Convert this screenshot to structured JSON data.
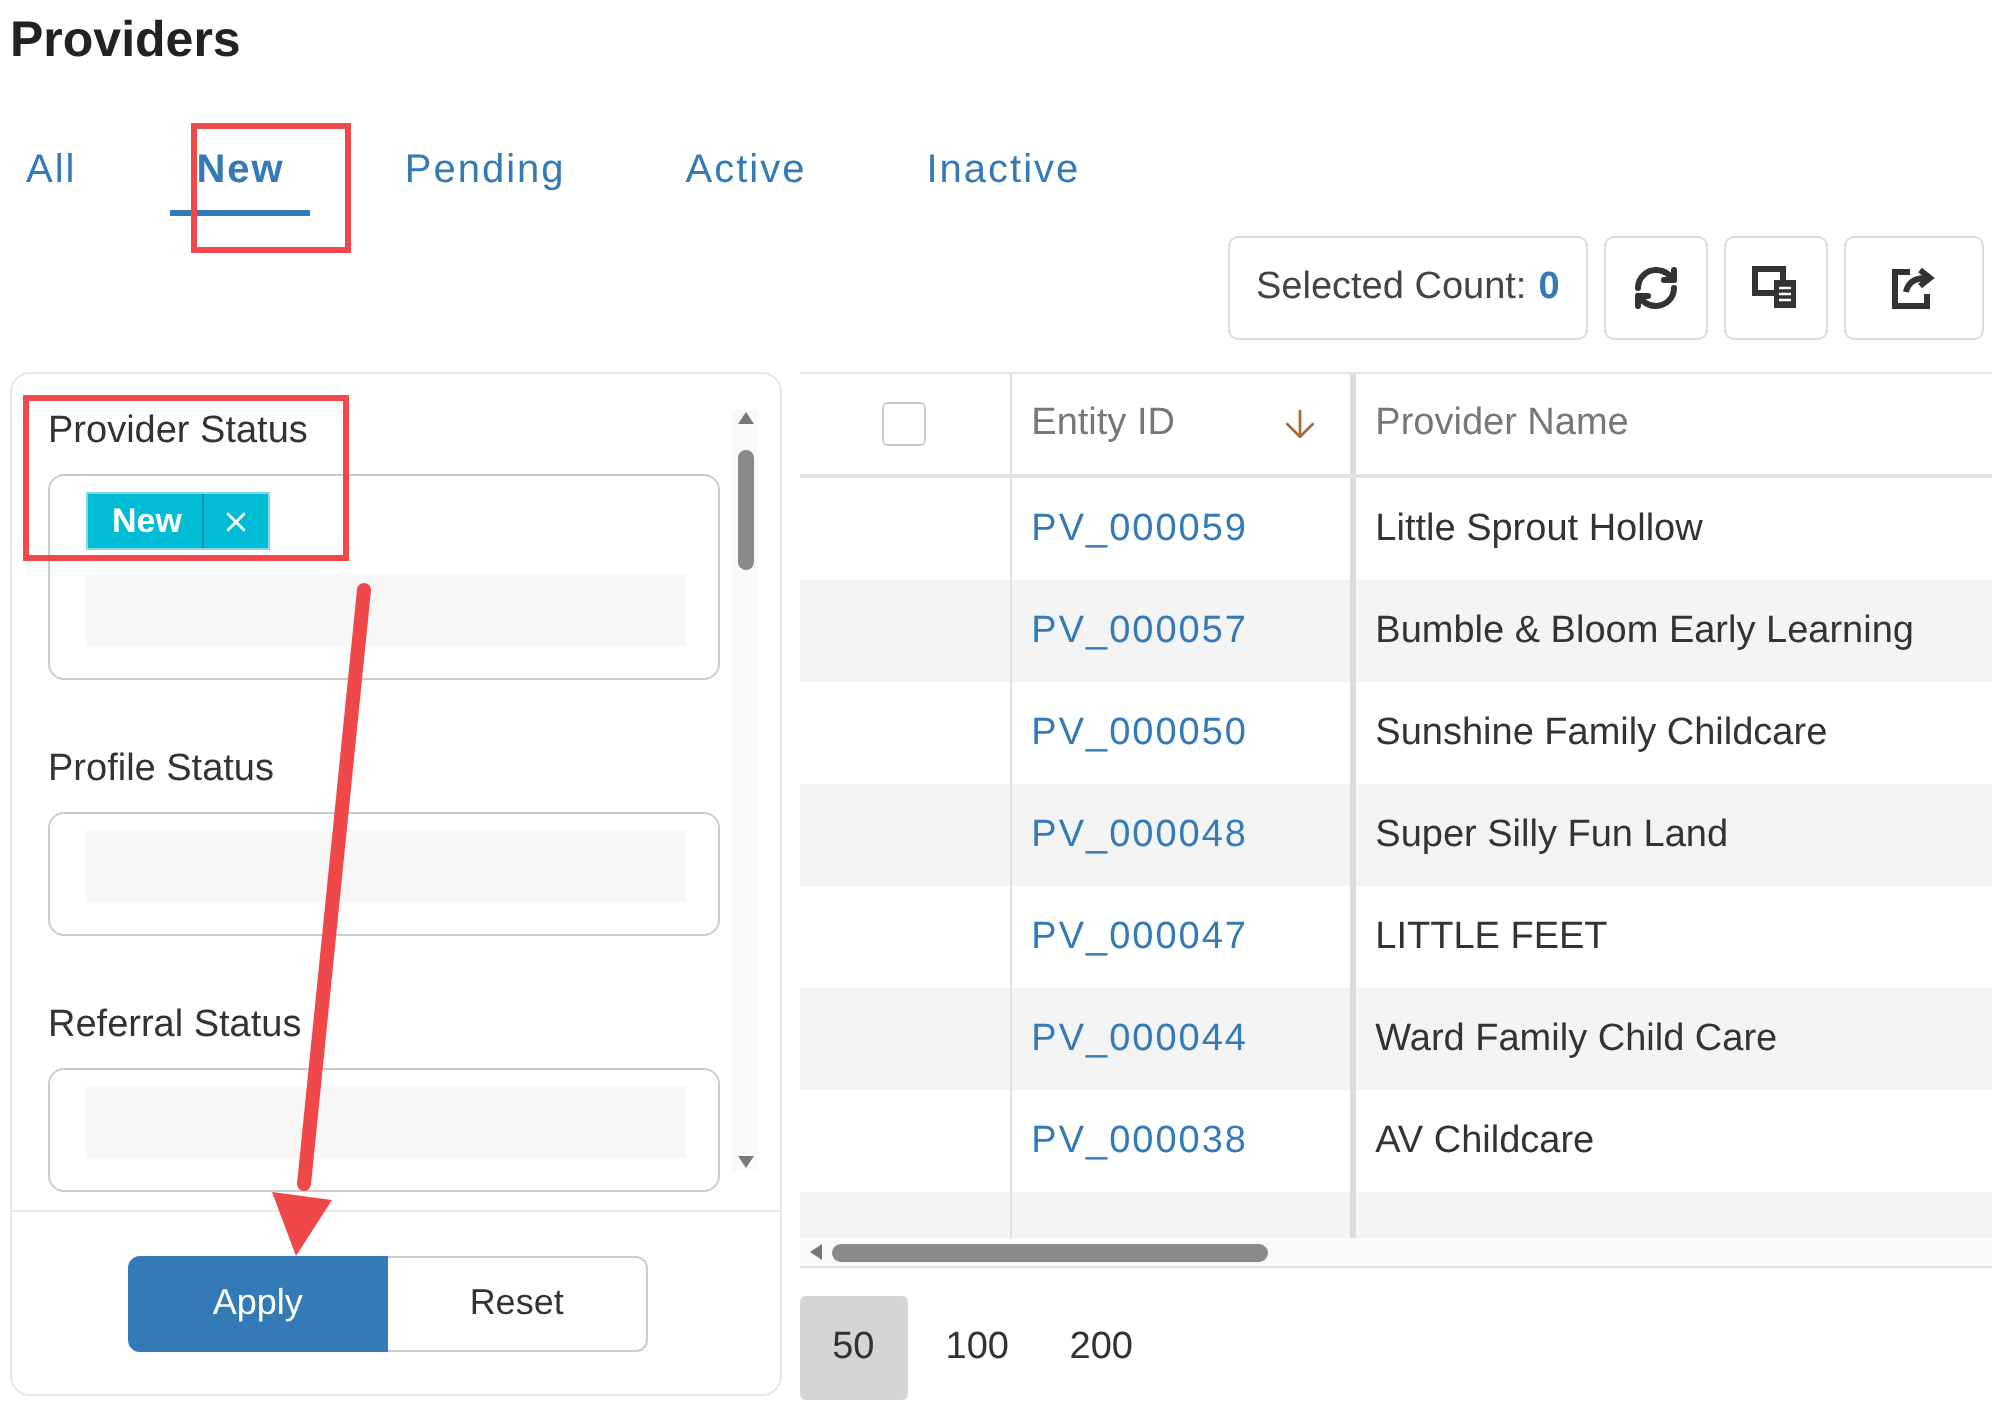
{
  "page": {
    "title": "Providers"
  },
  "tabs": [
    {
      "label": "All",
      "selected": false
    },
    {
      "label": "New",
      "selected": true
    },
    {
      "label": "Pending",
      "selected": false
    },
    {
      "label": "Active",
      "selected": false
    },
    {
      "label": "Inactive",
      "selected": false
    }
  ],
  "toolbar": {
    "selected_count_label": "Selected Count:",
    "selected_count": "0"
  },
  "filters": [
    {
      "label": "Provider Status",
      "chips": [
        {
          "label": "New"
        }
      ]
    },
    {
      "label": "Profile Status"
    },
    {
      "label": "Referral Status"
    }
  ],
  "filter_actions": [
    {
      "label": "Apply",
      "kind": "primary"
    },
    {
      "label": "Reset",
      "kind": "secondary"
    }
  ],
  "table": {
    "select_all_checked": false,
    "columns": [
      {
        "label": "Entity ID",
        "sorted": true,
        "descending": true
      },
      {
        "label": "Provider Name",
        "sorted": false
      }
    ],
    "rows": [
      {
        "id": "PV_000059",
        "name": "Little Sprout Hollow"
      },
      {
        "id": "PV_000057",
        "name": "Bumble & Bloom Early Learning"
      },
      {
        "id": "PV_000050",
        "name": "Sunshine Family Childcare"
      },
      {
        "id": "PV_000048",
        "name": "Super Silly Fun Land"
      },
      {
        "id": "PV_000047",
        "name": "LITTLE FEET"
      },
      {
        "id": "PV_000044",
        "name": "Ward Family Child Care"
      },
      {
        "id": "PV_000038",
        "name": "AV Childcare"
      }
    ]
  },
  "page_sizes": [
    {
      "label": "50",
      "selected": true
    },
    {
      "label": "100",
      "selected": false
    },
    {
      "label": "200",
      "selected": false
    }
  ]
}
